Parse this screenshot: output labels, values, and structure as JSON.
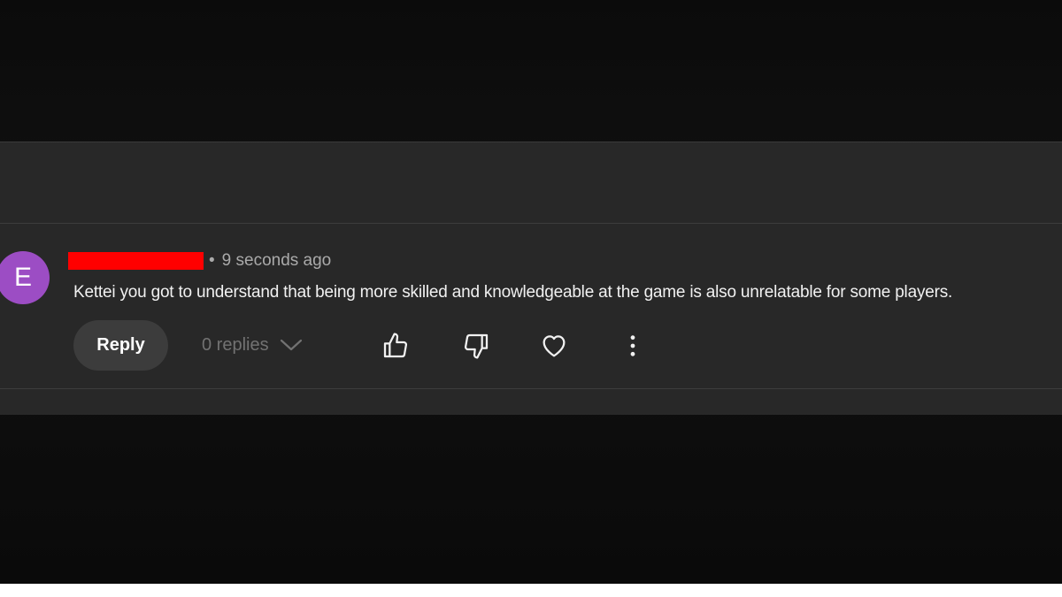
{
  "comment": {
    "avatar_letter": "E",
    "author": "",
    "separator": "•",
    "timestamp": "9 seconds ago",
    "text": "Kettei you got to understand that being more skilled and knowledgeable at the game is also unrelatable for some players."
  },
  "actions": {
    "reply_label": "Reply",
    "replies_label": "0 replies",
    "icons": [
      "thumbs-up-icon",
      "thumbs-down-icon",
      "heart-icon",
      "more-vertical-icon"
    ]
  },
  "colors": {
    "avatar": "#9c4dc4",
    "panel": "#282828",
    "redaction": "#ff0000"
  }
}
